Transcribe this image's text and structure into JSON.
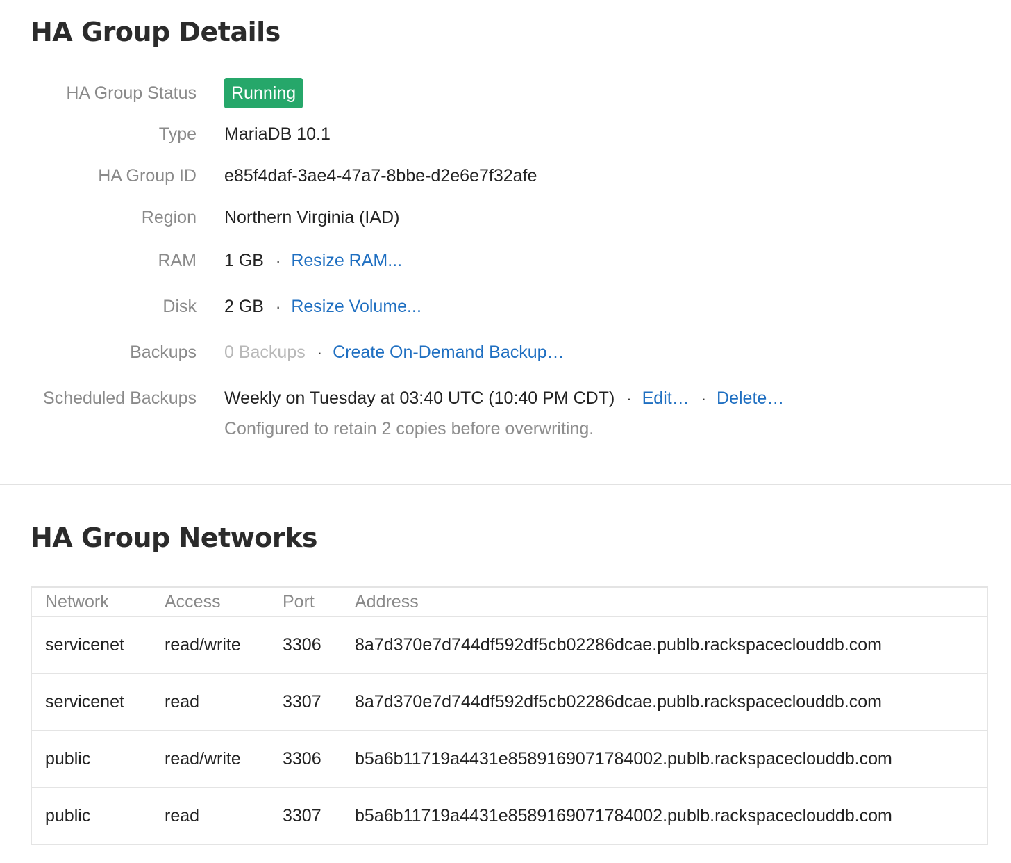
{
  "details": {
    "title": "HA Group Details",
    "status": {
      "label": "HA Group Status",
      "value": "Running",
      "color": "#26a76a"
    },
    "type": {
      "label": "Type",
      "value": "MariaDB 10.1"
    },
    "group_id": {
      "label": "HA Group ID",
      "value": "e85f4daf-3ae4-47a7-8bbe-d2e6e7f32afe"
    },
    "region": {
      "label": "Region",
      "value": "Northern Virginia (IAD)"
    },
    "ram": {
      "label": "RAM",
      "value": "1 GB",
      "separator": "·",
      "action": "Resize RAM..."
    },
    "disk": {
      "label": "Disk",
      "value": "2 GB",
      "separator": "·",
      "action": "Resize Volume..."
    },
    "backups": {
      "label": "Backups",
      "value": "0 Backups",
      "separator": "·",
      "action": "Create On-Demand Backup…"
    },
    "scheduled": {
      "label": "Scheduled Backups",
      "value": "Weekly on Tuesday at 03:40 UTC (10:40 PM CDT)",
      "separator": "·",
      "edit": "Edit…",
      "delete": "Delete…",
      "note": "Configured to retain 2 copies before overwriting."
    }
  },
  "networks": {
    "title": "HA Group Networks",
    "columns": [
      "Network",
      "Access",
      "Port",
      "Address"
    ],
    "rows": [
      {
        "network": "servicenet",
        "access": "read/write",
        "port": "3306",
        "address": "8a7d370e7d744df592df5cb02286dcae.publb.rackspaceclouddb.com"
      },
      {
        "network": "servicenet",
        "access": "read",
        "port": "3307",
        "address": "8a7d370e7d744df592df5cb02286dcae.publb.rackspaceclouddb.com"
      },
      {
        "network": "public",
        "access": "read/write",
        "port": "3306",
        "address": "b5a6b11719a4431e8589169071784002.publb.rackspaceclouddb.com"
      },
      {
        "network": "public",
        "access": "read",
        "port": "3307",
        "address": "b5a6b11719a4431e8589169071784002.publb.rackspaceclouddb.com"
      }
    ]
  },
  "colors": {
    "link": "#1f6fc1",
    "label": "#8a8a8a",
    "status_running": "#26a76a"
  }
}
